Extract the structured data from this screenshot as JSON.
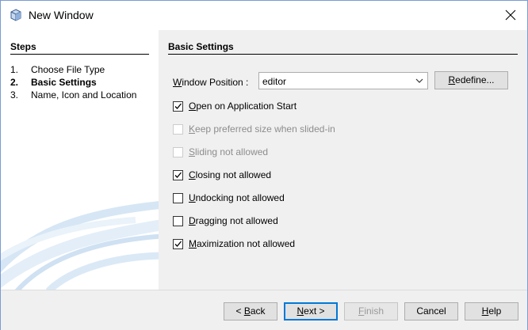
{
  "window": {
    "title": "New Window",
    "icons": {
      "app": "cube-icon",
      "close": "close-icon"
    }
  },
  "steps": {
    "header": "Steps",
    "items": [
      {
        "num": "1.",
        "label": "Choose File Type",
        "current": false
      },
      {
        "num": "2.",
        "label": "Basic Settings",
        "current": true
      },
      {
        "num": "3.",
        "label": "Name, Icon and Location",
        "current": false
      }
    ]
  },
  "panel": {
    "header": "Basic Settings",
    "window_position": {
      "label_prefix": "",
      "mnemonic": "W",
      "label_rest": "indow Position :",
      "value": "editor"
    },
    "redefine": {
      "mnemonic": "R",
      "rest": "edefine..."
    },
    "checkboxes": [
      {
        "mnemonic": "",
        "text_before": "",
        "text": "Open on Application Start",
        "checked": true,
        "enabled": true
      },
      {
        "mnemonic": "K",
        "text": "eep preferred size when slided-in",
        "checked": false,
        "enabled": false
      },
      {
        "mnemonic": "S",
        "text": "liding not allowed",
        "checked": false,
        "enabled": false
      },
      {
        "mnemonic": "C",
        "text": "losing not allowed",
        "checked": true,
        "enabled": true
      },
      {
        "mnemonic": "U",
        "text": "ndocking not allowed",
        "checked": false,
        "enabled": true
      },
      {
        "mnemonic": "D",
        "text": "ragging not allowed",
        "checked": false,
        "enabled": true
      },
      {
        "mnemonic": "M",
        "text": "aximization not allowed",
        "checked": true,
        "enabled": true
      }
    ]
  },
  "footer": {
    "back": {
      "prefix": "< ",
      "mnemonic": "B",
      "rest": "ack"
    },
    "next": {
      "mnemonic": "N",
      "rest": "ext >"
    },
    "finish": {
      "mnemonic": "F",
      "rest": "inish"
    },
    "cancel": "Cancel",
    "help": {
      "mnemonic": "H",
      "rest": "elp"
    }
  },
  "colors": {
    "accent": "#0078d7",
    "panel_bg": "#f0f0f0",
    "disabled_text": "#8d8d8d"
  }
}
